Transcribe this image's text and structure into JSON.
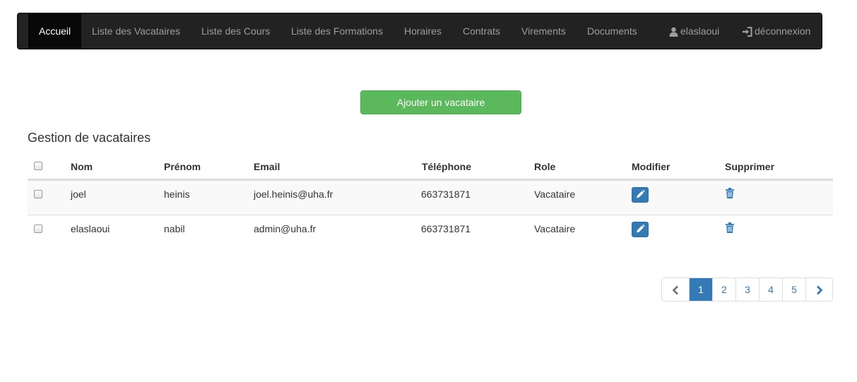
{
  "nav": {
    "items": [
      {
        "label": "Accueil",
        "active": true
      },
      {
        "label": "Liste des Vacataires"
      },
      {
        "label": "Liste des Cours"
      },
      {
        "label": "Liste des Formations"
      },
      {
        "label": "Horaires"
      },
      {
        "label": "Contrats"
      },
      {
        "label": "Virements"
      },
      {
        "label": "Documents"
      }
    ],
    "user": {
      "label": "elaslaoui",
      "icon": "user-icon"
    },
    "logout": {
      "label": "déconnexion",
      "icon": "logout-icon"
    }
  },
  "add_button": {
    "label": "Ajouter un vacataire"
  },
  "section_title": "Gestion de vacataires",
  "table": {
    "headers": [
      "Nom",
      "Prénom",
      "Email",
      "Téléphone",
      "Role",
      "Modifier",
      "Supprimer"
    ],
    "rows": [
      {
        "nom": "joel",
        "prenom": "heinis",
        "email": "joel.heinis@uha.fr",
        "telephone": "663731871",
        "role": "Vacataire"
      },
      {
        "nom": "elaslaoui",
        "prenom": "nabil",
        "email": "admin@uha.fr",
        "telephone": "663731871",
        "role": "Vacataire"
      }
    ]
  },
  "pagination": {
    "pages": [
      "1",
      "2",
      "3",
      "4",
      "5"
    ],
    "current": "1"
  },
  "colors": {
    "navbar": "#222222",
    "add_button": "#5cb85c",
    "primary": "#337ab7"
  }
}
